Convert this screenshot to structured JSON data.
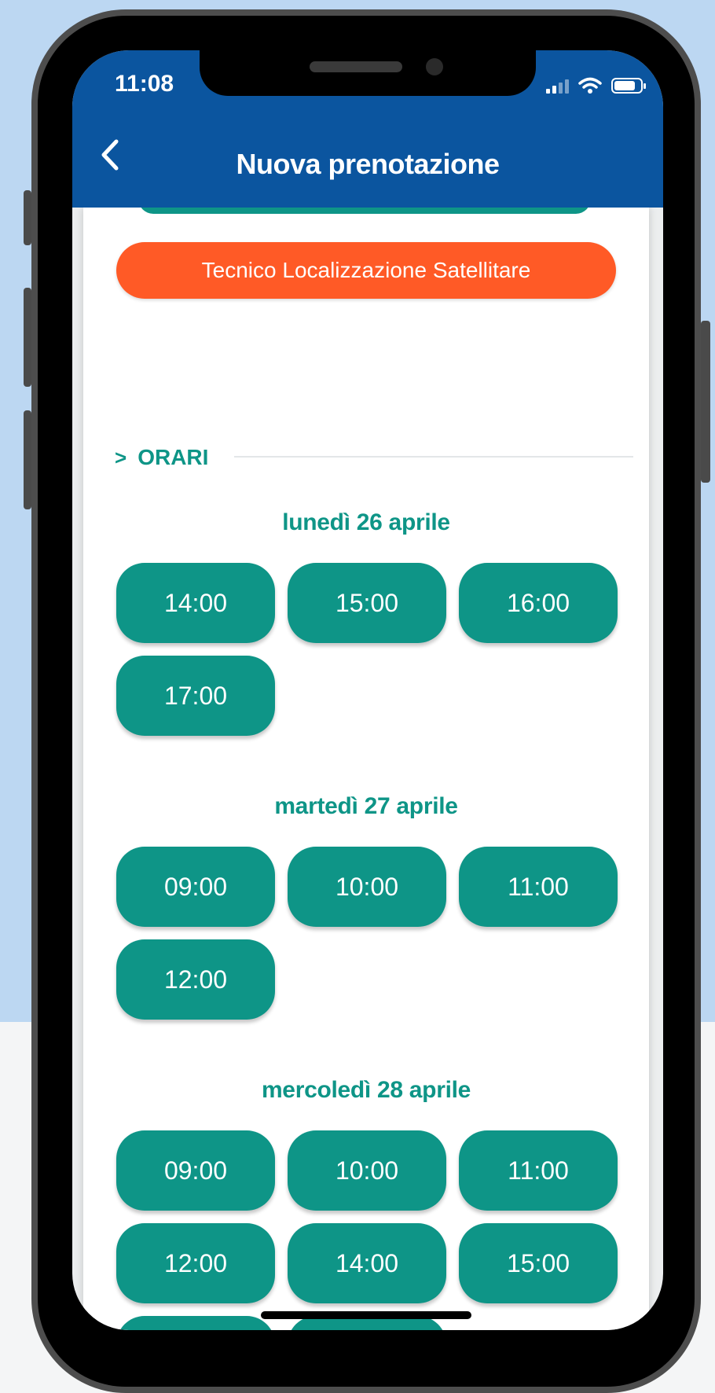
{
  "status_bar": {
    "time": "11:08"
  },
  "header": {
    "title": "Nuova prenotazione"
  },
  "service": {
    "label": "Tecnico Localizzazione Satellitare"
  },
  "section": {
    "label": "ORARI"
  },
  "days": [
    {
      "title": "lunedì 26 aprile",
      "slots": [
        "14:00",
        "15:00",
        "16:00",
        "17:00"
      ]
    },
    {
      "title": "martedì 27 aprile",
      "slots": [
        "09:00",
        "10:00",
        "11:00",
        "12:00"
      ]
    },
    {
      "title": "mercoledì 28 aprile",
      "slots": [
        "09:00",
        "10:00",
        "11:00",
        "12:00",
        "14:00",
        "15:00"
      ]
    }
  ],
  "colors": {
    "header_blue": "#0b559f",
    "accent_teal": "#0e9587",
    "service_orange": "#ff5a26"
  },
  "icons": {
    "back": "chevron-left-icon",
    "wifi": "wifi-icon",
    "battery": "battery-icon",
    "signal": "signal-icon"
  }
}
